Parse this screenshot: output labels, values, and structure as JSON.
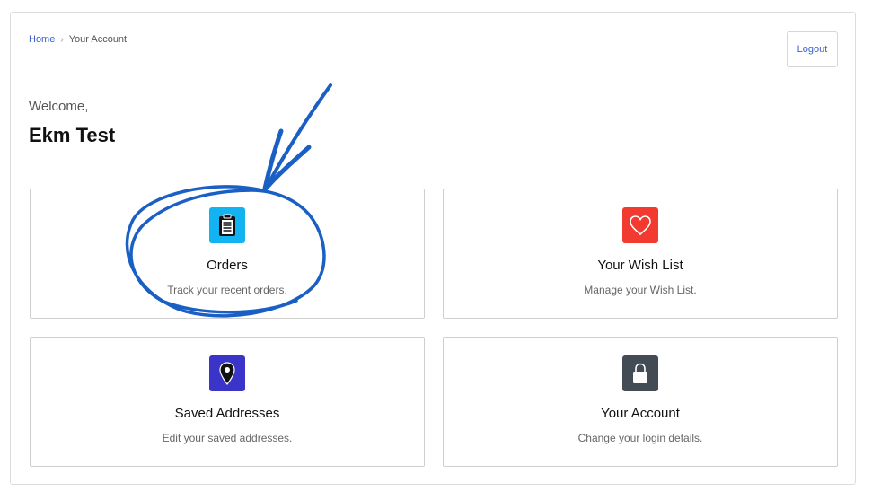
{
  "breadcrumb": {
    "home": "Home",
    "separator": "›",
    "current": "Your Account"
  },
  "header": {
    "logout_label": "Logout"
  },
  "welcome": {
    "greeting": "Welcome,",
    "name": "Ekm Test"
  },
  "cards": [
    {
      "title": "Orders",
      "description": "Track your recent orders.",
      "icon": "clipboard-icon",
      "color": "#12b3f0"
    },
    {
      "title": "Your Wish List",
      "description": "Manage your Wish List.",
      "icon": "heart-icon",
      "color": "#f23a30"
    },
    {
      "title": "Saved Addresses",
      "description": "Edit your saved addresses.",
      "icon": "map-pin-icon",
      "color": "#3a35c8"
    },
    {
      "title": "Your Account",
      "description": "Change your login details.",
      "icon": "lock-icon",
      "color": "#434b55"
    }
  ],
  "annotation": {
    "color": "#1a5fc4"
  }
}
